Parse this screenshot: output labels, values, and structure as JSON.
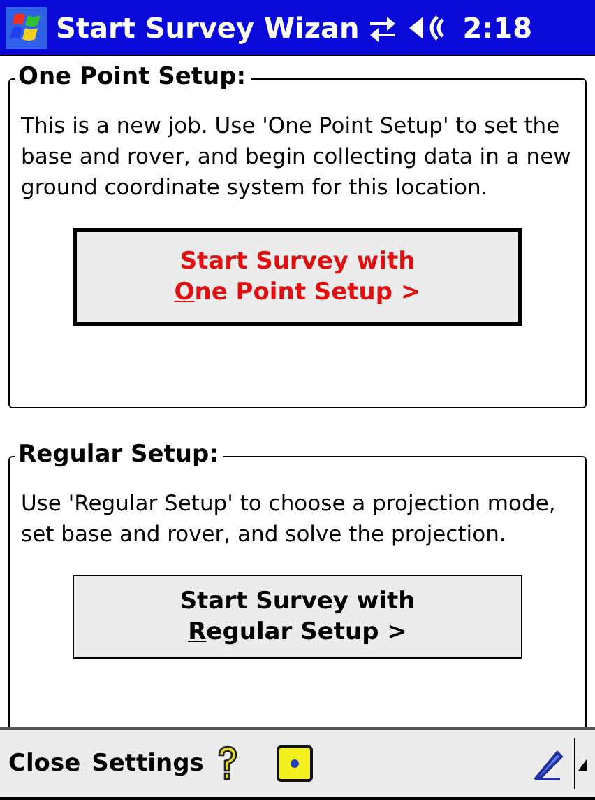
{
  "title_bar": {
    "title": "Start Survey Wizan",
    "time": "2:18"
  },
  "groups": [
    {
      "legend": "One Point Setup:",
      "text": "This is a new job. Use 'One Point Setup' to set the base and rover, and begin collecting data in a new ground coordinate system for this location.",
      "button": {
        "lines": [
          "Start Survey with",
          "One Point Setup >"
        ],
        "focused": true
      }
    },
    {
      "legend": "Regular Setup:",
      "text": "Use 'Regular Setup' to choose a projection mode, set base and rover, and solve the projection.",
      "button": {
        "lines": [
          "Start Survey with",
          "Regular Setup >"
        ],
        "focused": false
      }
    }
  ],
  "menu_bar": {
    "items": [
      "Close",
      "Settings"
    ]
  }
}
